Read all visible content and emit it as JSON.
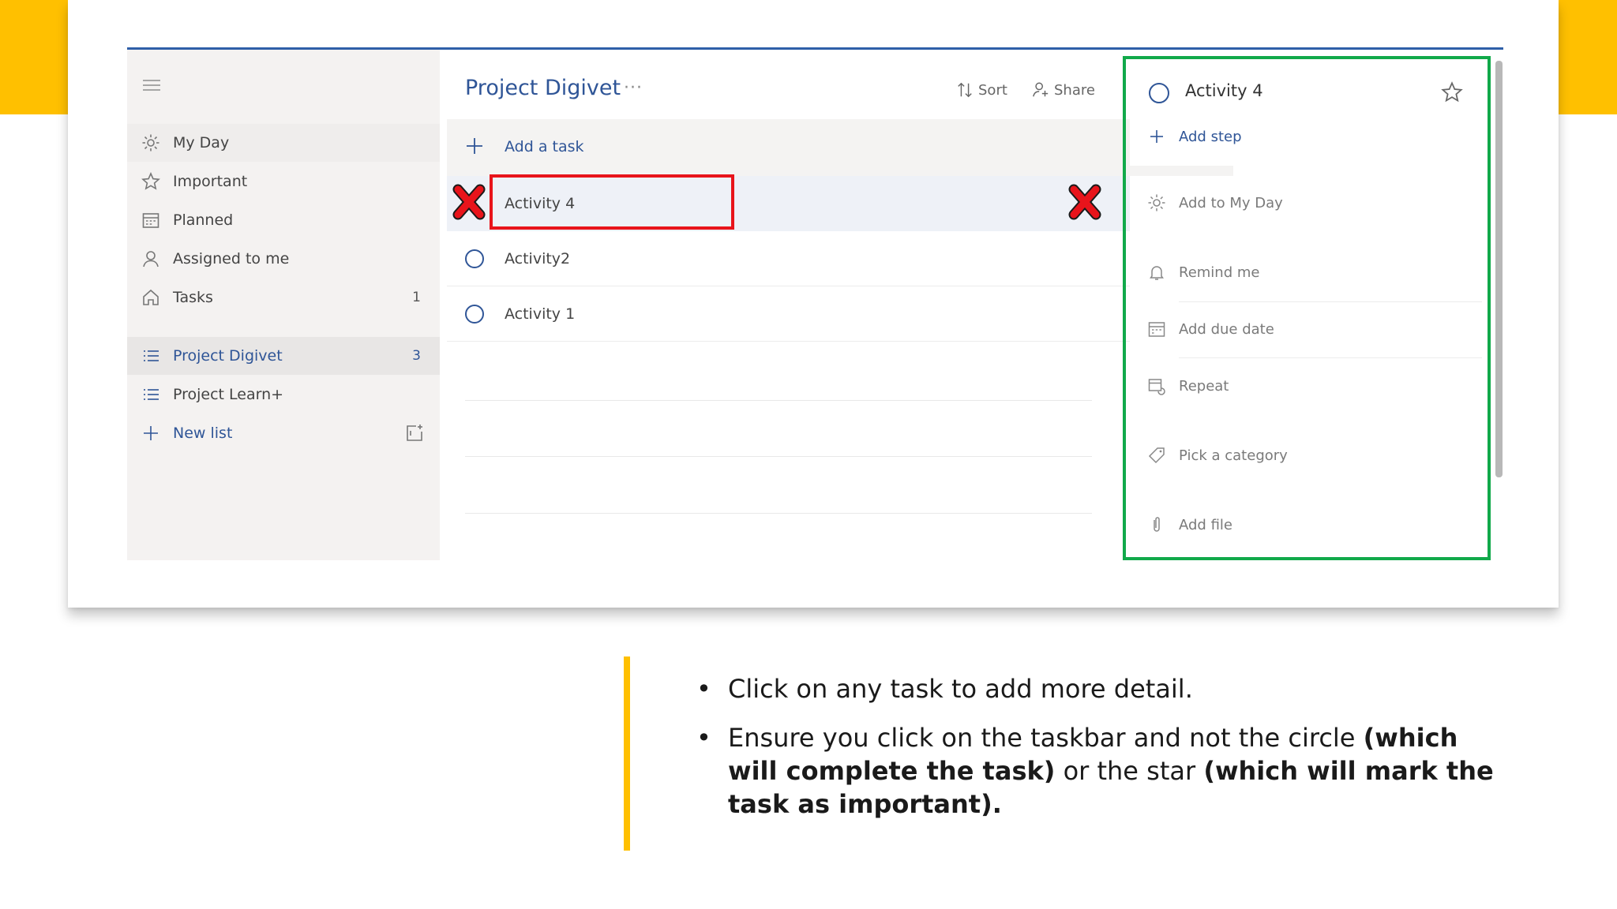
{
  "colors": {
    "accent_yellow": "#ffc000",
    "brand_blue": "#2f5597",
    "highlight_red": "#e8141b",
    "highlight_green": "#11a94a"
  },
  "sidebar": {
    "menu_icon": "hamburger-icon",
    "items": [
      {
        "label": "My Day",
        "icon": "sun-icon",
        "count": ""
      },
      {
        "label": "Important",
        "icon": "star-icon",
        "count": ""
      },
      {
        "label": "Planned",
        "icon": "calendar-icon",
        "count": ""
      },
      {
        "label": "Assigned to me",
        "icon": "person-icon",
        "count": ""
      },
      {
        "label": "Tasks",
        "icon": "home-icon",
        "count": "1"
      }
    ],
    "lists": [
      {
        "label": "Project Digivet",
        "icon": "list-icon",
        "count": "3"
      },
      {
        "label": "Project Learn+",
        "icon": "list-icon",
        "count": ""
      }
    ],
    "new_list_label": "New list"
  },
  "main": {
    "title": "Project Digivet",
    "more": "···",
    "sort_label": "Sort",
    "share_label": "Share",
    "add_task_label": "Add a task",
    "tasks": [
      {
        "title": "Activity 4"
      },
      {
        "title": "Activity2"
      },
      {
        "title": "Activity 1"
      }
    ]
  },
  "detail": {
    "title": "Activity 4",
    "add_step": "Add step",
    "add_to_my_day": "Add to My Day",
    "remind_me": "Remind me",
    "add_due_date": "Add due date",
    "repeat": "Repeat",
    "pick_category": "Pick a category",
    "add_file": "Add file"
  },
  "notes": {
    "bullet1": "Click on any task to add more detail.",
    "bullet2_a": "Ensure you click on the taskbar and not the circle ",
    "bullet2_b": "(which will complete the task)",
    "bullet2_c": " or the star ",
    "bullet2_d": "(which will mark the task as important)."
  }
}
